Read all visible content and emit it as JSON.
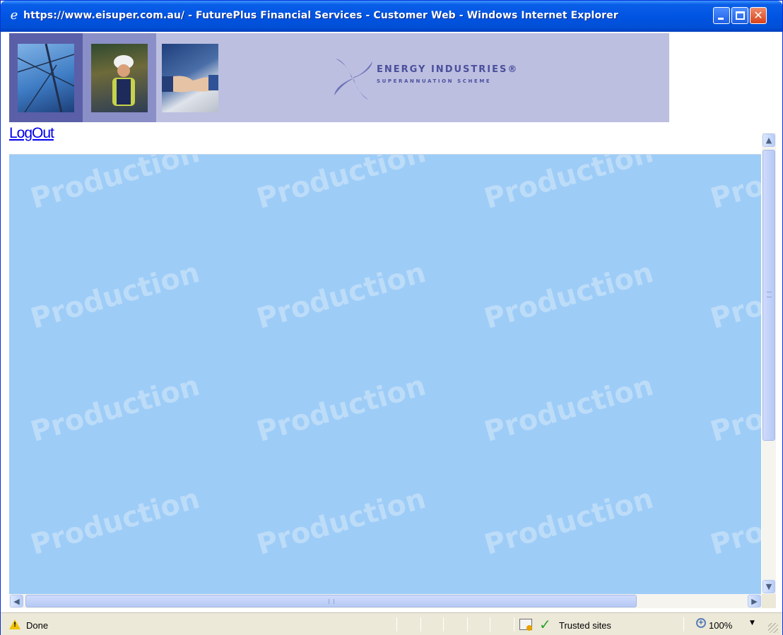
{
  "window": {
    "title": "https://www.eisuper.com.au/ - FuturePlus Financial Services - Customer Web - Windows Internet Explorer",
    "app_icon": "ie-icon",
    "controls": [
      "minimize-icon",
      "maximize-icon",
      "close-icon"
    ]
  },
  "banner": {
    "logo_title": "ENERGY INDUSTRIES®",
    "logo_subtitle": "SUPERANNUATION SCHEME"
  },
  "page": {
    "logout_label": "LogOut",
    "watermark_text": "Production",
    "background_color": "#9dccf7"
  },
  "statusbar": {
    "status_text": "Done",
    "zone_text": "Trusted sites",
    "zoom_text": "100%"
  }
}
